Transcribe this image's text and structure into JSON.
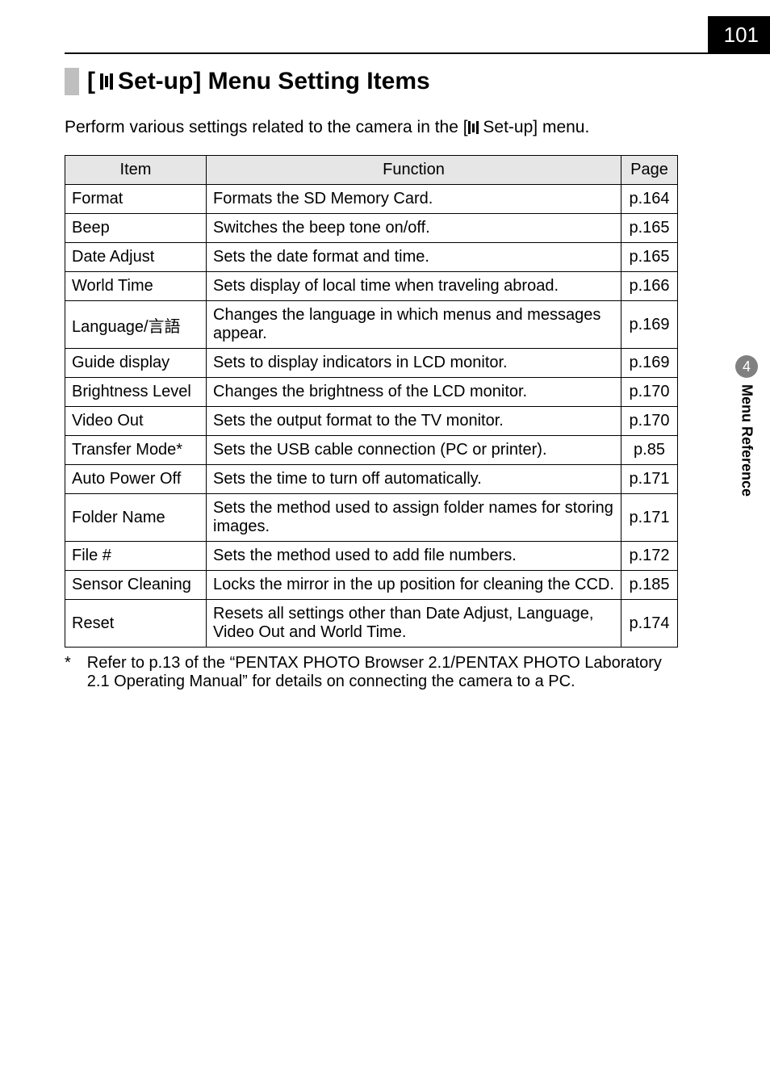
{
  "page_number": "101",
  "heading": {
    "prefix": "[",
    "title_text": " Set-up] Menu Setting Items"
  },
  "intro": {
    "before": "Perform various settings related to the camera in the [",
    "after": " Set-up] menu."
  },
  "table": {
    "headers": {
      "item": "Item",
      "function": "Function",
      "page": "Page"
    },
    "rows": [
      {
        "item": "Format",
        "function": "Formats the SD Memory Card.",
        "page": "p.164"
      },
      {
        "item": "Beep",
        "function": "Switches the beep tone on/off.",
        "page": "p.165"
      },
      {
        "item": "Date Adjust",
        "function": "Sets the date format and time.",
        "page": "p.165"
      },
      {
        "item": "World Time",
        "function": "Sets display of local time when traveling abroad.",
        "page": "p.166"
      },
      {
        "item": "Language/言語",
        "function": "Changes the language in which menus and messages appear.",
        "page": "p.169"
      },
      {
        "item": "Guide display",
        "function": "Sets to display indicators in LCD monitor.",
        "page": "p.169"
      },
      {
        "item": "Brightness Level",
        "function": "Changes the brightness of the LCD monitor.",
        "page": "p.170"
      },
      {
        "item": "Video Out",
        "function": "Sets the output format to the TV monitor.",
        "page": "p.170"
      },
      {
        "item": "Transfer Mode*",
        "function": "Sets the USB cable connection (PC or printer).",
        "page": "p.85"
      },
      {
        "item": "Auto Power Off",
        "function": "Sets the time to turn off automatically.",
        "page": "p.171"
      },
      {
        "item": "Folder Name",
        "function": "Sets the method used to assign folder names for storing images.",
        "page": "p.171"
      },
      {
        "item": "File #",
        "function": "Sets the method used to add file numbers.",
        "page": "p.172"
      },
      {
        "item": "Sensor Cleaning",
        "function": "Locks the mirror in the up position for cleaning the CCD.",
        "page": "p.185"
      },
      {
        "item": "Reset",
        "function": "Resets all settings other than Date Adjust, Language, Video Out and World Time.",
        "page": "p.174"
      }
    ]
  },
  "footnote": {
    "star": "*",
    "text": "Refer to p.13 of the “PENTAX PHOTO Browser 2.1/PENTAX PHOTO Laboratory 2.1 Operating Manual” for details on connecting the camera to a PC."
  },
  "side_tab": {
    "chapter_number": "4",
    "chapter_label": "Menu Reference"
  }
}
